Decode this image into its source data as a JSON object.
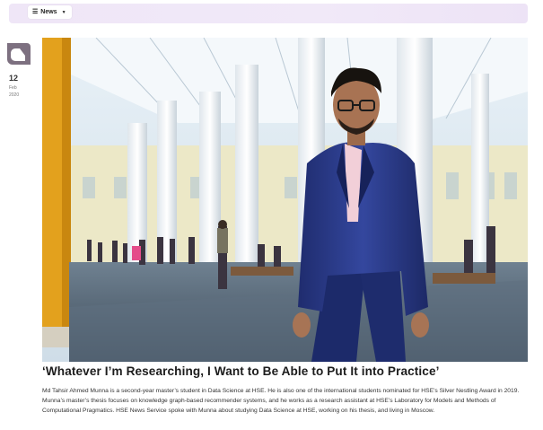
{
  "nav": {
    "tab_label": "News"
  },
  "logo": {
    "icon": "hse-logo-icon",
    "color": "#7d7080"
  },
  "post": {
    "date": {
      "day": "12",
      "month": "Feb",
      "year": "2020"
    },
    "image": {
      "description_icon": "photo-portrait"
    },
    "title": "‘Whatever I’m Researching, I Want to Be Able to Put It into Practice’",
    "lead": "Md Tahsir Ahmed Munna is a second-year master’s student in Data Science at HSE. He is also one of the international students nominated for HSE’s Silver Nestling Award in 2019. Munna’s master’s thesis focuses on knowledge graph-based recommender systems, and he works as a research assistant at HSE’s Laboratory for Models and Methods of Computational Pragmatics. HSE News Service spoke with Munna about studying Data Science at HSE, working on his thesis, and living in Moscow."
  },
  "colors": {
    "topbar": "#efe6f7",
    "suit": "#2b3a8f",
    "column_accent": "#e3a11d"
  }
}
